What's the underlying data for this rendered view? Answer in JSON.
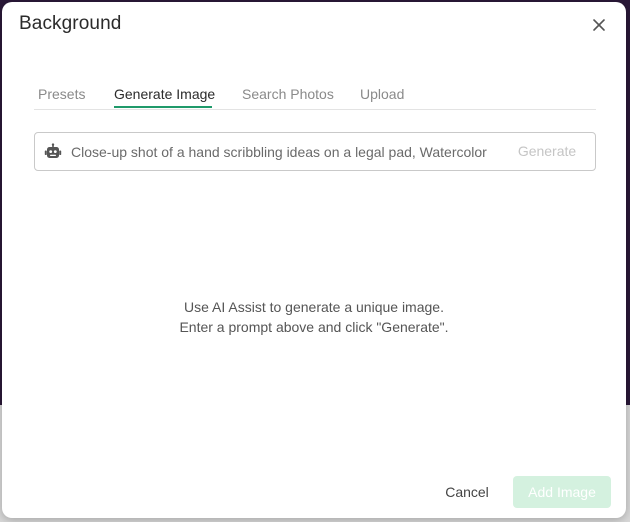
{
  "dialog": {
    "title": "Background",
    "close_icon": "close-icon"
  },
  "tabs": [
    {
      "label": "Presets",
      "active": false
    },
    {
      "label": "Generate Image",
      "active": true
    },
    {
      "label": "Search Photos",
      "active": false
    },
    {
      "label": "Upload",
      "active": false
    }
  ],
  "prompt": {
    "icon": "robot-icon",
    "value": "Close-up shot of a hand scribbling ideas on a legal pad, Watercolor",
    "generate_label": "Generate"
  },
  "hint": {
    "line1": "Use AI Assist to generate a unique image.",
    "line2": "Enter a prompt above and click \"Generate\"."
  },
  "footer": {
    "cancel_label": "Cancel",
    "add_label": "Add Image"
  },
  "colors": {
    "accent": "#1f9a6a",
    "add_button_disabled": "#d4f1df",
    "backdrop": "#2a1838"
  }
}
